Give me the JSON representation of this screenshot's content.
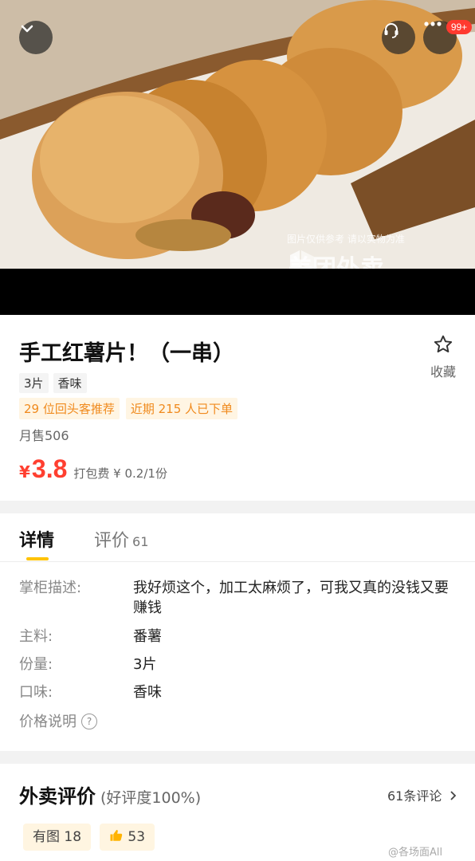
{
  "hero": {
    "notification_badge": "99+",
    "watermark_note": "图片仅供参考 请以实物为准",
    "watermark_brand": "美团外卖"
  },
  "product": {
    "title": "手工红薯片！（一串）",
    "favorite_label": "收藏",
    "tags": [
      "3片",
      "香味"
    ],
    "promos": [
      "29 位回头客推荐",
      "近期 215 人已下单"
    ],
    "monthly_sales": "月售506",
    "price_symbol": "¥",
    "price": "3.8",
    "packing_fee": "打包费 ¥ 0.2/1份"
  },
  "tabs": {
    "details": "详情",
    "reviews": "评价",
    "reviews_count": "61"
  },
  "details": {
    "rows": [
      {
        "label": "掌柜描述:",
        "value": "我好烦这个，加工太麻烦了，可我又真的没钱又要赚钱"
      },
      {
        "label": "主料:",
        "value": "番薯"
      },
      {
        "label": "份量:",
        "value": "3片"
      },
      {
        "label": "口味:",
        "value": "香味"
      },
      {
        "label": "价格说明",
        "value": ""
      }
    ],
    "help_glyph": "?"
  },
  "reviews": {
    "title": "外卖评价",
    "rating": "(好评度100%)",
    "more": "61条评论",
    "chips": [
      {
        "label": "有图",
        "count": "18"
      },
      {
        "label": "",
        "count": "53"
      }
    ],
    "weibo_mark": "@各场面All"
  },
  "colors": {
    "price": "#ff3f30",
    "promo_text": "#f08a1d",
    "tab_underline": "#ffc300",
    "badge": "#ff3a2f"
  }
}
